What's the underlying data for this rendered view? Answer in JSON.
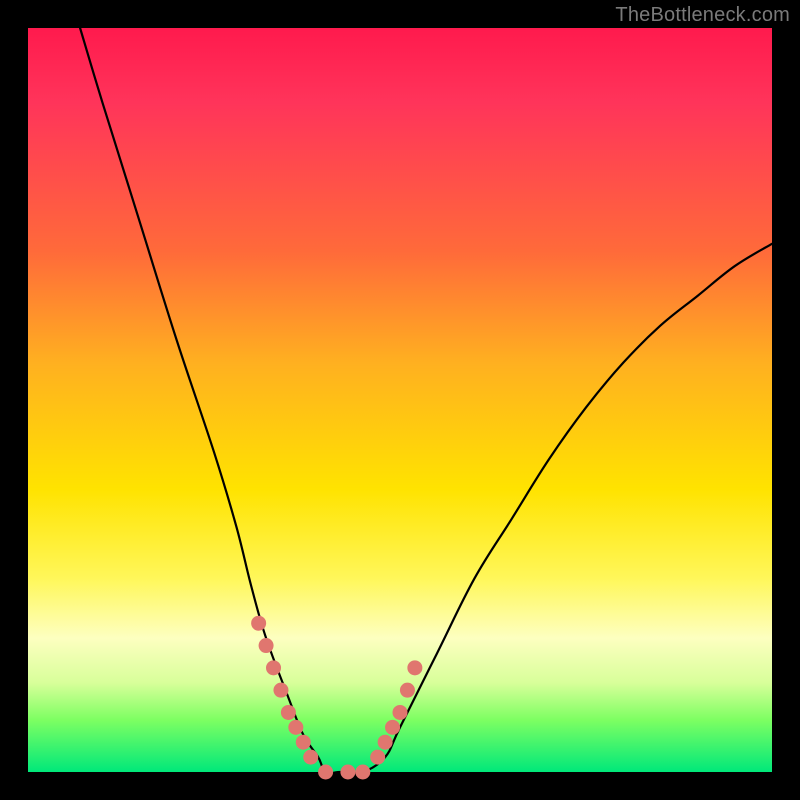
{
  "watermark": "TheBottleneck.com",
  "chart_data": {
    "type": "line",
    "title": "",
    "xlabel": "",
    "ylabel": "",
    "xlim": [
      0,
      100
    ],
    "ylim": [
      0,
      100
    ],
    "grid": false,
    "legend": false,
    "series": [
      {
        "name": "curve",
        "color": "#000000",
        "x": [
          7,
          10,
          15,
          20,
          25,
          28,
          30,
          32,
          35,
          37,
          39,
          40,
          42,
          45,
          48,
          50,
          55,
          60,
          65,
          70,
          75,
          80,
          85,
          90,
          95,
          100
        ],
        "values": [
          100,
          90,
          74,
          58,
          43,
          33,
          25,
          18,
          10,
          5,
          2,
          0,
          0,
          0,
          2,
          6,
          16,
          26,
          34,
          42,
          49,
          55,
          60,
          64,
          68,
          71
        ]
      },
      {
        "name": "highlight-dots",
        "color": "#e0766f",
        "x": [
          31,
          32,
          33,
          34,
          35,
          36,
          37,
          38,
          40,
          43,
          45,
          47,
          48,
          49,
          50,
          51,
          52
        ],
        "values": [
          20,
          17,
          14,
          11,
          8,
          6,
          4,
          2,
          0,
          0,
          0,
          2,
          4,
          6,
          8,
          11,
          14
        ]
      }
    ],
    "gradient_stops": [
      {
        "pos": 0.0,
        "color": "#ff1a4d"
      },
      {
        "pos": 0.3,
        "color": "#ff6a3a"
      },
      {
        "pos": 0.62,
        "color": "#ffe300"
      },
      {
        "pos": 0.82,
        "color": "#fdffc0"
      },
      {
        "pos": 1.0,
        "color": "#00e87a"
      }
    ]
  }
}
